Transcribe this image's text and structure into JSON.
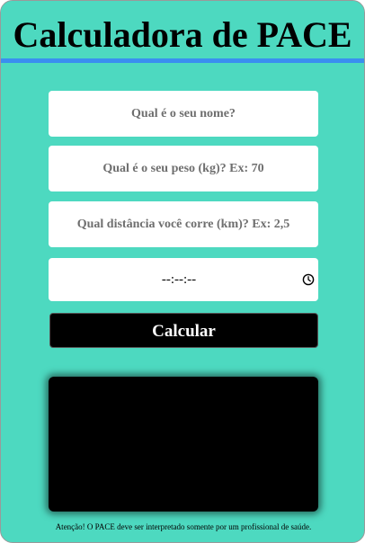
{
  "header": {
    "title": "Calculadora de PACE"
  },
  "form": {
    "name_placeholder": "Qual é o seu nome?",
    "weight_placeholder": "Qual é o seu peso (kg)? Ex: 70",
    "distance_placeholder": "Qual distância você corre (km)? Ex: 2,5",
    "time_value": "--:--:--",
    "time_icon": "clock-icon",
    "submit_label": "Calcular"
  },
  "result": {
    "text": ""
  },
  "footer": {
    "note": "Atenção! O PACE deve ser interpretado somente por um profissional de saúde."
  },
  "colors": {
    "background": "#4dd9c0",
    "header_border": "#3a8ff0",
    "button": "#000000",
    "result_box": "#000000"
  }
}
